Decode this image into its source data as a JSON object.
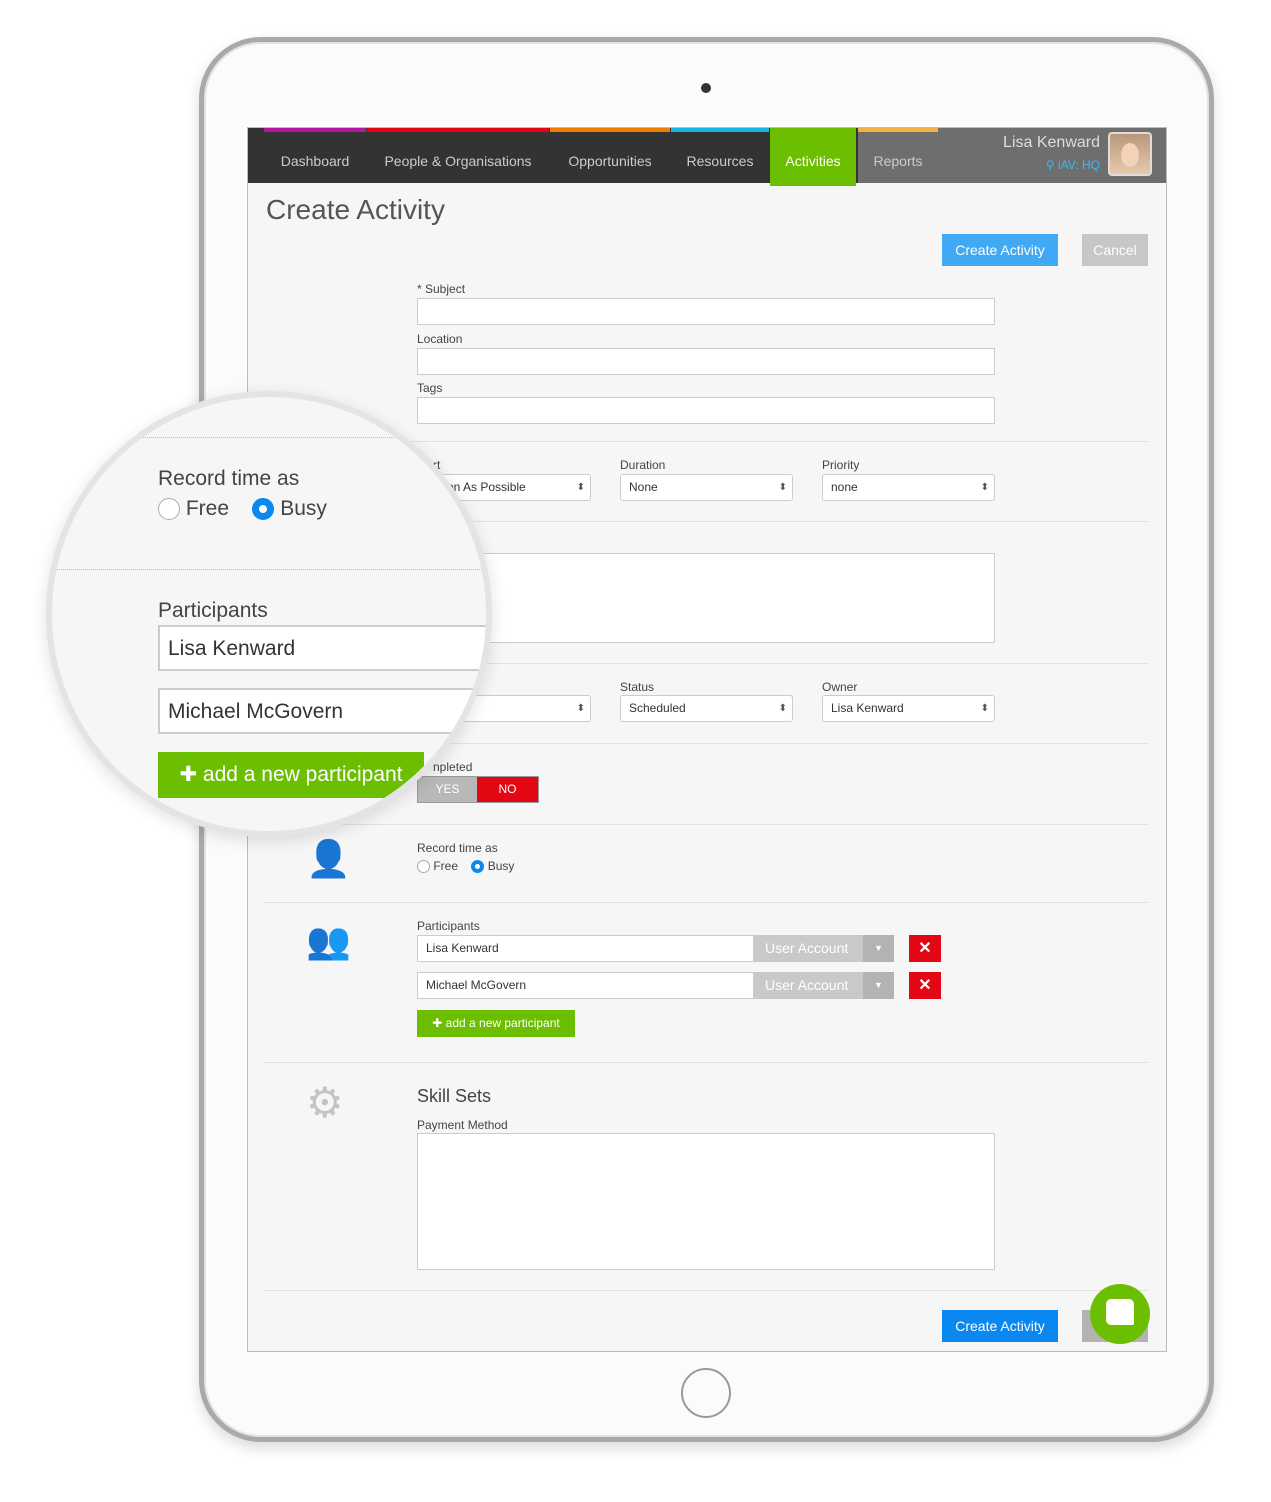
{
  "nav": {
    "items": [
      {
        "label": "Dashboard",
        "color": "#b5169e"
      },
      {
        "label": "People & Organisations",
        "color": "#e30613"
      },
      {
        "label": "Opportunities",
        "color": "#f07d00"
      },
      {
        "label": "Resources",
        "color": "#1ab3e6"
      },
      {
        "label": "Activities",
        "color": "#6cbe00",
        "active": true
      },
      {
        "label": "Reports",
        "color": "#f6b042"
      }
    ],
    "user_name": "Lisa Kenward",
    "location": "iAV: HQ"
  },
  "page_title": "Create Activity",
  "buttons": {
    "create": "Create Activity",
    "cancel": "Cancel",
    "add_participant": "add a new participant"
  },
  "form": {
    "subject_label": "* Subject",
    "location_label": "Location",
    "tags_label": "Tags",
    "start_label": "rt",
    "start_value": "on As Possible",
    "duration_label": "Duration",
    "duration_value": "None",
    "priority_label": "Priority",
    "priority_value": "none",
    "status_label": "Status",
    "status_value": "Scheduled",
    "owner_label": "Owner",
    "owner_value": "Lisa Kenward",
    "completed_label": "npleted",
    "yes": "YES",
    "no": "NO",
    "record_time_label": "Record time as",
    "free": "Free",
    "busy": "Busy",
    "record_time_selected": "Busy",
    "participants_label": "Participants",
    "participants": [
      {
        "name": "Lisa Kenward",
        "type": "User Account"
      },
      {
        "name": "Michael McGovern",
        "type": "User Account"
      }
    ],
    "skill_sets_title": "Skill Sets",
    "payment_method_label": "Payment Method"
  },
  "magnifier": {
    "record_time_label": "Record time as",
    "free": "Free",
    "busy": "Busy",
    "participants_label": "Participants",
    "participants": [
      "Lisa Kenward",
      "Michael McGovern"
    ],
    "add_participant": "add a new participant"
  }
}
